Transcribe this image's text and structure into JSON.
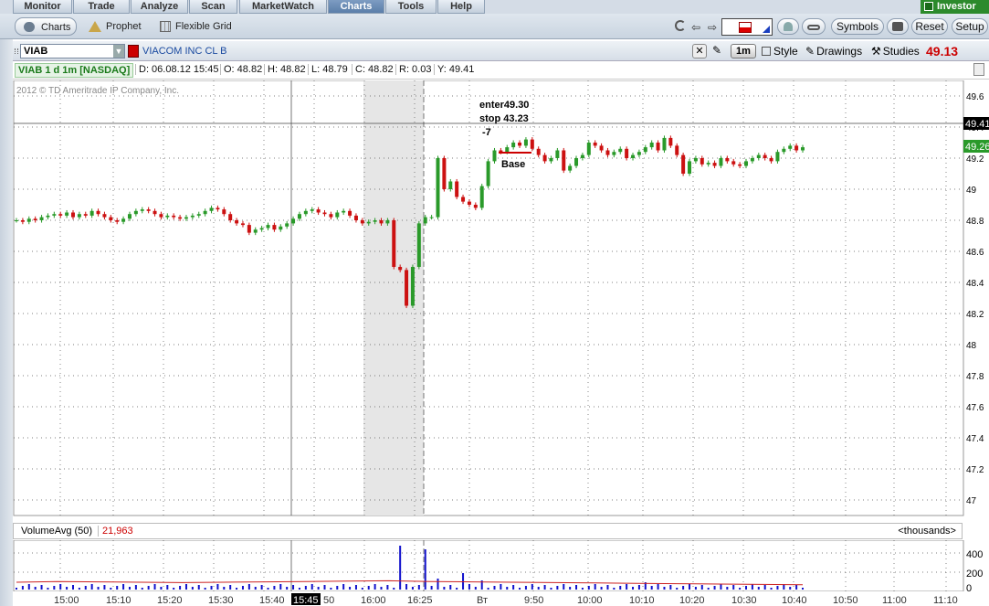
{
  "nav": {
    "tabs": [
      "Monitor",
      "Trade",
      "Analyze",
      "Scan",
      "MarketWatch",
      "Charts",
      "Tools",
      "Help"
    ],
    "active": "Charts",
    "investor": "Investor"
  },
  "subnav": {
    "charts": "Charts",
    "prophet": "Prophet",
    "flexible_grid": "Flexible Grid",
    "symbols": "Symbols",
    "reset": "Reset",
    "setup": "Setup"
  },
  "chartbar": {
    "symbol": "VIAB",
    "company": "VIACOM INC CL B",
    "interval": "1m",
    "style": "Style",
    "drawings": "Drawings",
    "studies": "Studies",
    "last_price": "49.13"
  },
  "infobar": {
    "title": "VIAB 1 d 1m [NASDAQ]",
    "date": "D: 06.08.12 15:45",
    "open": "O: 48.82",
    "high": "H: 48.82",
    "low": "L: 48.79",
    "close": "C: 48.82",
    "range": "R: 0.03",
    "y": "Y: 49.41"
  },
  "copyright": "2012 © TD Ameritrade IP Company, Inc.",
  "annotations": {
    "enter": "enter49.30",
    "stop": "stop 43.23",
    "minus": "-7",
    "base": "Base"
  },
  "price_axis": {
    "labels": [
      "49.6",
      "49.4",
      "49.2",
      "49",
      "48.8",
      "48.6",
      "48.4",
      "48.2",
      "48",
      "47.8",
      "47.6",
      "47.4",
      "47.2",
      "47"
    ],
    "current": "49.41",
    "last": "49.26"
  },
  "volume": {
    "label": "VolumeAvg (50)",
    "value": "21,963",
    "units": "<thousands>",
    "axis": [
      "400",
      "200",
      "0"
    ]
  },
  "time_axis": {
    "labels": [
      "15:00",
      "15:10",
      "15:20",
      "15:30",
      "15:40",
      "15:45",
      "50",
      "16:00",
      "16:25",
      "Вт",
      "9:50",
      "10:00",
      "10:10",
      "10:20",
      "10:30",
      "10:40",
      "10:50",
      "11:00",
      "11:10"
    ]
  },
  "colors": {
    "up": "#2a9a2a",
    "down": "#cc1111",
    "accent": "#cc0000",
    "volume": "#1111cc"
  },
  "chart_data": {
    "type": "candlestick",
    "ylim": [
      46.9,
      49.7
    ],
    "closes": [
      48.8,
      48.79,
      48.81,
      48.8,
      48.82,
      48.83,
      48.84,
      48.83,
      48.85,
      48.82,
      48.84,
      48.83,
      48.86,
      48.84,
      48.82,
      48.8,
      48.79,
      48.81,
      48.84,
      48.86,
      48.87,
      48.86,
      48.84,
      48.82,
      48.83,
      48.82,
      48.81,
      48.82,
      48.83,
      48.84,
      48.86,
      48.88,
      48.87,
      48.84,
      48.8,
      48.78,
      48.77,
      48.72,
      48.74,
      48.75,
      48.77,
      48.74,
      48.76,
      48.78,
      48.81,
      48.84,
      48.86,
      48.87,
      48.85,
      48.84,
      48.82,
      48.85,
      48.86,
      48.83,
      48.8,
      48.78,
      48.79,
      48.8,
      48.78,
      48.8,
      48.5,
      48.48,
      48.25,
      48.5,
      48.78,
      48.82,
      48.82,
      49.2,
      49.0,
      49.05,
      48.95,
      48.92,
      48.9,
      48.88,
      49.02,
      49.18,
      49.25,
      49.24,
      49.27,
      49.3,
      49.28,
      49.32,
      49.26,
      49.22,
      49.18,
      49.2,
      49.25,
      49.12,
      49.15,
      49.2,
      49.22,
      49.3,
      49.28,
      49.25,
      49.22,
      49.24,
      49.26,
      49.2,
      49.22,
      49.24,
      49.27,
      49.3,
      49.25,
      49.33,
      49.28,
      49.22,
      49.1,
      49.18,
      49.2,
      49.16,
      49.17,
      49.15,
      49.2,
      49.18,
      49.16,
      49.15,
      49.18,
      49.2,
      49.22,
      49.2,
      49.18,
      49.24,
      49.26,
      49.28,
      49.25,
      49.27
    ],
    "volume_avg": [
      20,
      22,
      21,
      20,
      19,
      20,
      21,
      22,
      23,
      24,
      22,
      21,
      20,
      19,
      18,
      17,
      16,
      15,
      14,
      13
    ],
    "levels": {
      "enter": 49.3,
      "stop": 43.23,
      "current": 49.41
    }
  }
}
